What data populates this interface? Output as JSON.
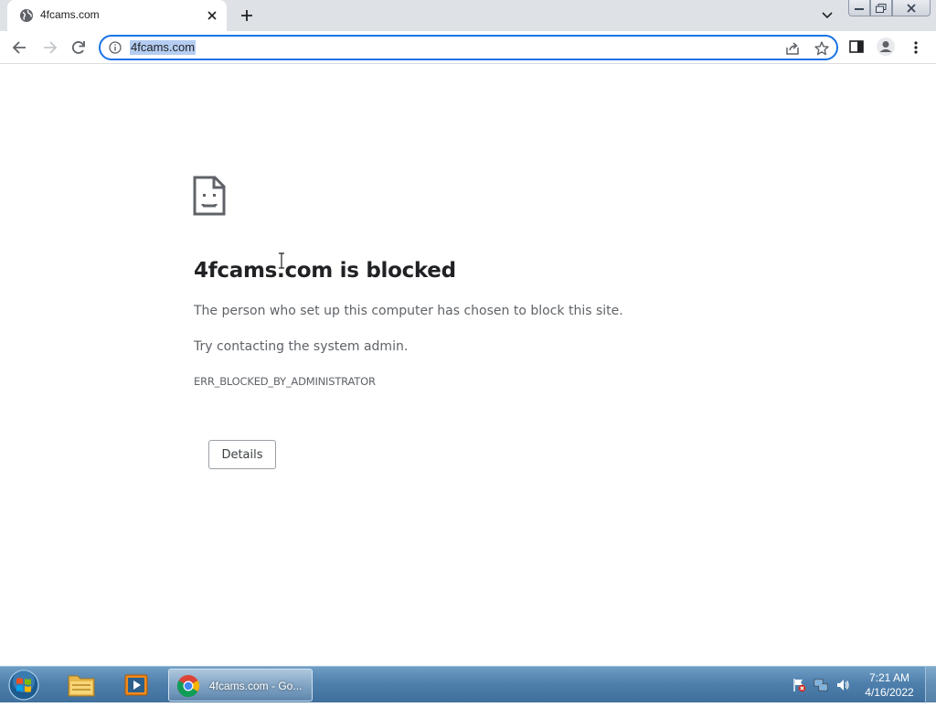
{
  "browser": {
    "tab": {
      "title": "4fcams.com",
      "favicon": "globe-icon",
      "close_icon": "close-icon"
    },
    "new_tab_icon": "plus-icon",
    "tab_search_icon": "chevron-down-icon",
    "toolbar": {
      "back_icon": "arrow-left-icon",
      "forward_icon": "arrow-right-icon",
      "reload_icon": "reload-icon",
      "omnibox": {
        "url": "4fcams.com",
        "site_info_icon": "info-icon",
        "share_icon": "share-icon",
        "bookmark_icon": "star-icon"
      },
      "side_panel_icon": "side-panel-icon",
      "profile_icon": "profile-icon",
      "menu_icon": "kebab-menu-icon"
    },
    "accent_color": "#1a73e8"
  },
  "page": {
    "icon": "sad-file-icon",
    "heading": "4fcams.com is blocked",
    "message": "The person who set up this computer has chosen to block this site.",
    "suggestion": "Try contacting the system admin.",
    "error_code": "ERR_BLOCKED_BY_ADMINISTRATOR",
    "details_button": "Details"
  },
  "taskbar": {
    "start_icon": "windows-start-icon",
    "pinned": [
      {
        "name": "Windows Explorer",
        "icon": "folder-icon"
      },
      {
        "name": "Windows Media Player",
        "icon": "media-player-icon"
      }
    ],
    "active_window": {
      "label": "4fcams.com - Go...",
      "icon": "chrome-icon"
    },
    "tray_icons": [
      "action-center-flag-icon",
      "network-icon",
      "volume-icon"
    ],
    "clock": {
      "time": "7:21 AM",
      "date": "4/16/2022"
    }
  }
}
